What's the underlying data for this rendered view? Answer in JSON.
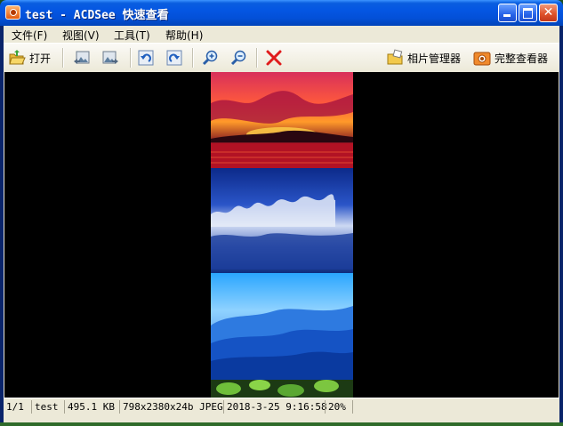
{
  "window": {
    "title": "test - ACDSee 快速查看"
  },
  "menu": [
    "文件(F)",
    "视图(V)",
    "工具(T)",
    "帮助(H)"
  ],
  "toolbar": {
    "open_label": "打开",
    "photo_manager_label": "相片管理器",
    "full_viewer_label": "完整查看器",
    "icons": [
      "open-folder-icon",
      "previous-image-icon",
      "next-image-icon",
      "rotate-left-icon",
      "rotate-right-icon",
      "zoom-in-icon",
      "zoom-out-icon",
      "delete-icon",
      "photo-manager-icon",
      "full-viewer-icon"
    ]
  },
  "status": {
    "index": "1/1",
    "filename": "test",
    "filesize": "495.1 KB",
    "dimensions": "798x2380x24b JPEG",
    "datetime": "2018-3-25 9:16:58",
    "zoom": "20%"
  },
  "colors": {
    "title_blue": "#0456e2",
    "close_red": "#e0532b",
    "delete_red": "#e01c1c",
    "chrome": "#ece9d8"
  }
}
